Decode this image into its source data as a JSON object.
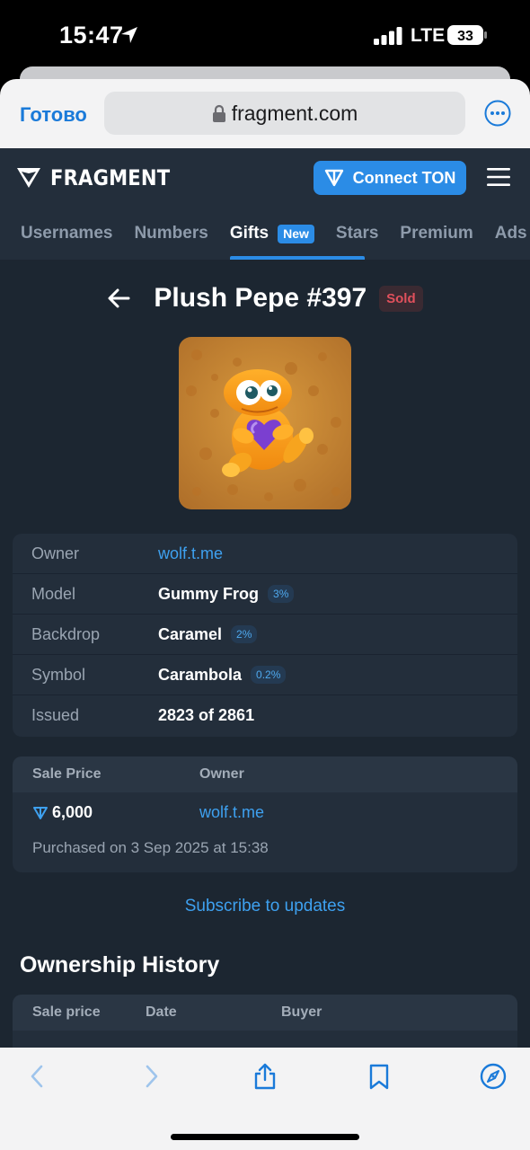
{
  "status_bar": {
    "time": "15:47",
    "network": "LTE",
    "battery": "33"
  },
  "browser": {
    "done_label": "Готово",
    "url": "fragment.com"
  },
  "site": {
    "logo_text": "FRAGMENT",
    "connect_label": "Connect TON",
    "tabs": [
      {
        "label": "Usernames"
      },
      {
        "label": "Numbers"
      },
      {
        "label": "Gifts",
        "badge": "New"
      },
      {
        "label": "Stars"
      },
      {
        "label": "Premium"
      },
      {
        "label": "Ads"
      }
    ]
  },
  "gift": {
    "title": "Plush Pepe #397",
    "status": "Sold",
    "details": [
      {
        "label": "Owner",
        "value": "wolf.t.me",
        "link": true
      },
      {
        "label": "Model",
        "value": "Gummy Frog",
        "rarity": "3%"
      },
      {
        "label": "Backdrop",
        "value": "Caramel",
        "rarity": "2%"
      },
      {
        "label": "Symbol",
        "value": "Carambola",
        "rarity": "0.2%"
      },
      {
        "label": "Issued",
        "value": "2823 of 2861"
      }
    ]
  },
  "sale": {
    "price_header": "Sale Price",
    "owner_header": "Owner",
    "price": "6,000",
    "owner": "wolf.t.me",
    "purchased": "Purchased on 3 Sep 2025 at 15:38"
  },
  "subscribe_label": "Subscribe to updates",
  "history": {
    "title": "Ownership History",
    "columns": [
      "Sale price",
      "Date",
      "Buyer"
    ]
  },
  "colors": {
    "accent": "#2b8ce6",
    "link": "#3ea1f0",
    "page_bg": "#1c2631",
    "panel_bg": "#232e3b",
    "sold": "#e0505c"
  }
}
